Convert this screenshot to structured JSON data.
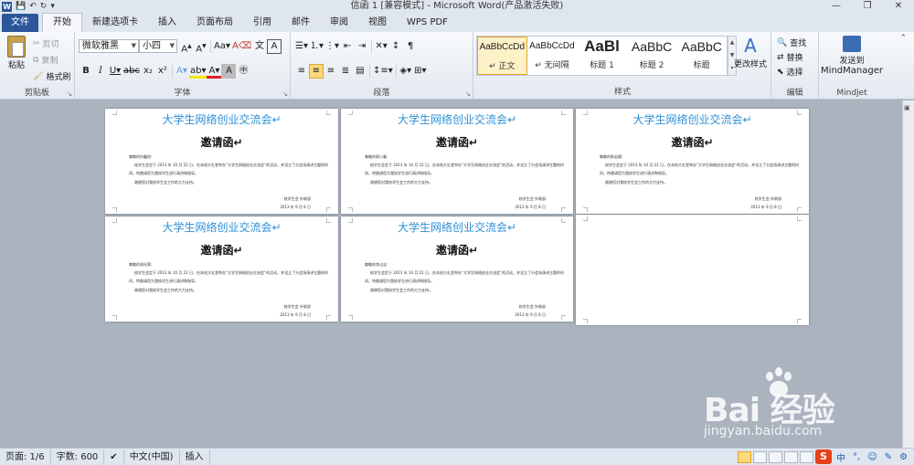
{
  "window": {
    "title": "信函 1 [兼容模式] - Microsoft Word(产品激活失败)",
    "controls": [
      "—",
      "❐",
      "✕"
    ]
  },
  "tabs": [
    {
      "label": "文件"
    },
    {
      "label": "开始"
    },
    {
      "label": "新建选项卡"
    },
    {
      "label": "插入"
    },
    {
      "label": "页面布局"
    },
    {
      "label": "引用"
    },
    {
      "label": "邮件"
    },
    {
      "label": "审阅"
    },
    {
      "label": "视图"
    },
    {
      "label": "WPS PDF"
    }
  ],
  "ribbon": {
    "clipboard": {
      "paste": "粘贴",
      "cut": "剪切",
      "copy": "复制",
      "format_painter": "格式刷",
      "label": "剪贴板"
    },
    "font": {
      "font_name": "微软雅黑",
      "font_size": "小四",
      "label": "字体"
    },
    "paragraph": {
      "label": "段落"
    },
    "styles": {
      "label": "样式",
      "items": [
        {
          "preview": "AaBbCcDd",
          "name": "↵ 正文"
        },
        {
          "preview": "AaBbCcDd",
          "name": "↵ 无间隔"
        },
        {
          "preview": "AaBl",
          "name": "标题 1"
        },
        {
          "preview": "AaBbC",
          "name": "标题 2"
        },
        {
          "preview": "AaBbC",
          "name": "标题"
        }
      ],
      "change_styles": "更改样式"
    },
    "editing": {
      "find": "查找",
      "replace": "替换",
      "select": "选择",
      "label": "编辑"
    },
    "mindjet": {
      "send": "发送到",
      "target": "MindManager",
      "label": "Mindjet"
    }
  },
  "pages": [
    {
      "title": "大学生网络创业交流会↵",
      "heading": "邀请函↵",
      "greeting": "尊敬的何鑫他:",
      "body1": "校学生会定于 2013 年 10 月 22 日，在本校大礼堂举办“大学生网络创业交流会”的活动，并设立了分会场演讲主题的时",
      "body2": "间，特邀请您为我校学生进行演讲和指导。",
      "body3": "谢谢您对我校学生会工作的大力支持。",
      "sign": "校学生会 外联部",
      "date": "2013 年 9 月 8 日"
    },
    {
      "title": "大学生网络创业交流会↵",
      "heading": "邀请函↵",
      "greeting": "尊敬的郭小春:",
      "body1": "校学生会定于 2013 年 10 月 22 日，在本校大礼堂举办“大学生网络创业交流会”的活动，并设立了分会场演讲主题的时",
      "body2": "间，特邀请您为我校学生进行演讲和指导。",
      "body3": "谢谢您对我校学生会工作的大力支持。",
      "sign": "校学生会 外联部",
      "date": "2013 年 9 月 8 日"
    },
    {
      "title": "大学生网络创业交流会↵",
      "heading": "邀请函↵",
      "greeting": "尊敬的陈岩捷:",
      "body1": "校学生会定于 2013 年 10 月 22 日，在本校大礼堂举办“大学生网络创业交流会”的活动，并设立了分会场演讲主题的时",
      "body2": "间，特邀请您为我校学生进行演讲和指导。",
      "body3": "谢谢您对我校学生会工作的大力支持。",
      "sign": "校学生会 外联部",
      "date": "2013 年 9 月 8 日"
    },
    {
      "title": "大学生网络创业交流会↵",
      "heading": "邀请函↵",
      "greeting": "尊敬的胡光荣:",
      "body1": "校学生会定于 2013 年 10 月 22 日，在本校大礼堂举办“大学生网络创业交流会”的活动，并设立了分会场演讲主题的时",
      "body2": "间，特邀请您为我校学生进行演讲和指导。",
      "body3": "谢谢您对我校学生会工作的大力支持。",
      "sign": "校学生会 外联部",
      "date": "2013 年 9 月 8 日"
    },
    {
      "title": "大学生网络创业交流会↵",
      "heading": "邀请函↵",
      "greeting": "尊敬的李达志:",
      "body1": "校学生会定于 2013 年 10 月 22 日，在本校大礼堂举办“大学生网络创业交流会”的活动，并设立了分会场演讲主题的时",
      "body2": "间，特邀请您为我校学生进行演讲和指导。",
      "body3": "谢谢您对我校学生会工作的大力支持。",
      "sign": "校学生会 外联部",
      "date": "2013 年 9 月 8 日"
    }
  ],
  "statusbar": {
    "page": "页面: 1/6",
    "words": "字数: 600",
    "language": "中文(中国)",
    "mode": "插入",
    "ime_items": [
      "中",
      "°,",
      "☺",
      "✎",
      "⚙"
    ]
  },
  "watermark": {
    "brand": "Bai  经验",
    "url": "jingyan.baidu.com"
  },
  "colors": {
    "accent": "#2b579a",
    "title_blue": "#2e8fd6",
    "selected": "#fbd97c"
  }
}
